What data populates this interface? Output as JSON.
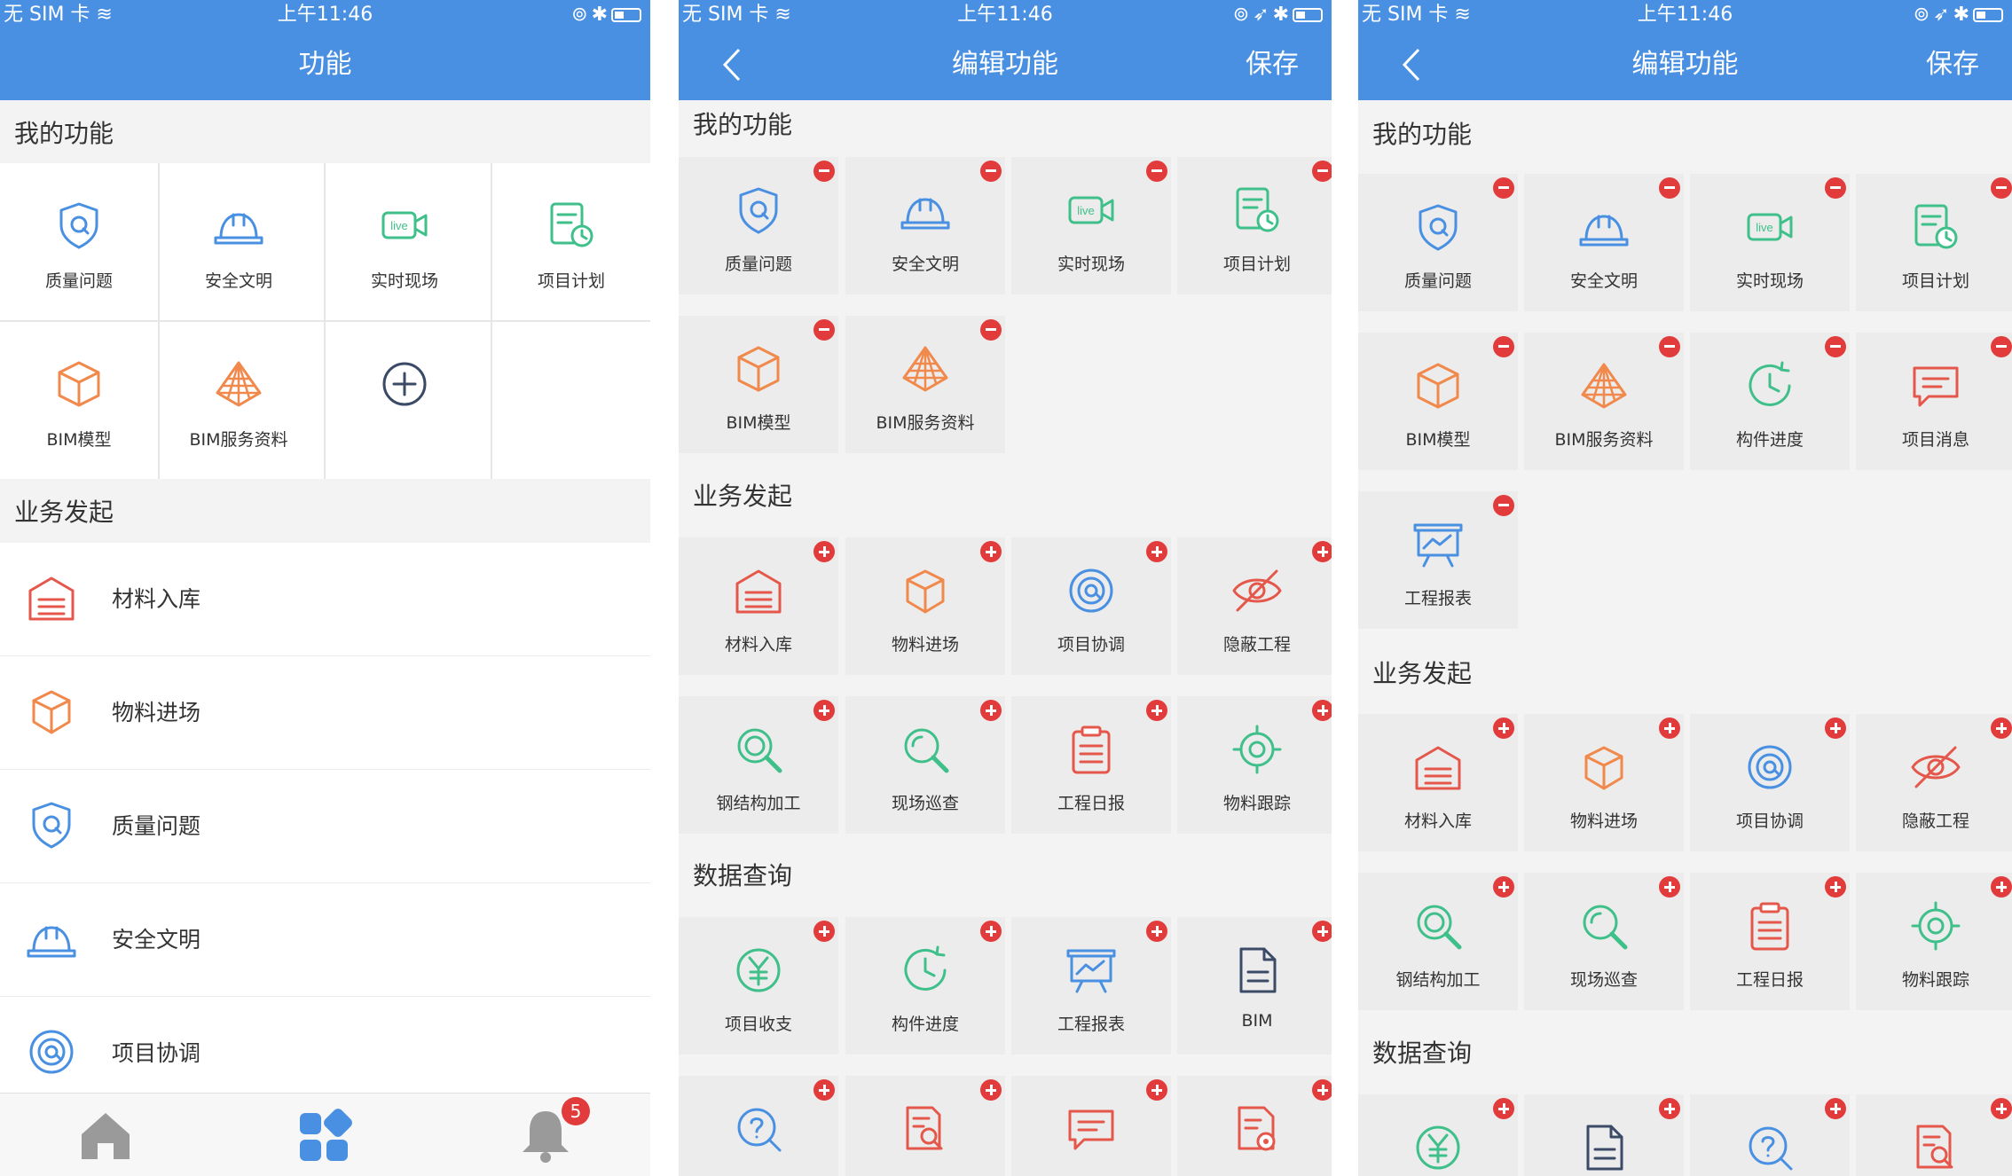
{
  "status_bar": {
    "carrier": "无 SIM 卡",
    "time": "上午11:46"
  },
  "screen1": {
    "title": "功能",
    "section_mine": "我的功能",
    "mine": [
      {
        "label": "质量问题",
        "icon": "shield-q-icon"
      },
      {
        "label": "安全文明",
        "icon": "helmet-icon"
      },
      {
        "label": "实时现场",
        "icon": "live-camera-icon"
      },
      {
        "label": "项目计划",
        "icon": "plan-icon"
      },
      {
        "label": "BIM模型",
        "icon": "cube-icon"
      },
      {
        "label": "BIM服务资料",
        "icon": "pyramid-icon"
      }
    ],
    "section_business": "业务发起",
    "business": [
      {
        "label": "材料入库",
        "icon": "warehouse-icon"
      },
      {
        "label": "物料进场",
        "icon": "box-icon"
      },
      {
        "label": "质量问题",
        "icon": "shield-q-icon"
      },
      {
        "label": "安全文明",
        "icon": "helmet-icon"
      },
      {
        "label": "项目协调",
        "icon": "coordination-icon"
      }
    ],
    "tabs": [
      "home-icon",
      "apps-icon",
      "bell-icon"
    ],
    "notification_count": "5"
  },
  "screen2": {
    "title": "编辑功能",
    "save_label": "保存",
    "section_mine": "我的功能",
    "mine": [
      {
        "label": "质量问题",
        "icon": "shield-q-icon"
      },
      {
        "label": "安全文明",
        "icon": "helmet-icon"
      },
      {
        "label": "实时现场",
        "icon": "live-camera-icon"
      },
      {
        "label": "项目计划",
        "icon": "plan-icon"
      },
      {
        "label": "BIM模型",
        "icon": "cube-icon"
      },
      {
        "label": "BIM服务资料",
        "icon": "pyramid-icon"
      }
    ],
    "section_business": "业务发起",
    "business": [
      {
        "label": "材料入库",
        "icon": "warehouse-icon"
      },
      {
        "label": "物料进场",
        "icon": "box-icon"
      },
      {
        "label": "项目协调",
        "icon": "coordination-icon"
      },
      {
        "label": "隐蔽工程",
        "icon": "hidden-eye-icon"
      },
      {
        "label": "钢结构加工",
        "icon": "steel-search-icon"
      },
      {
        "label": "现场巡查",
        "icon": "inspection-icon"
      },
      {
        "label": "工程日报",
        "icon": "daily-report-icon"
      },
      {
        "label": "物料跟踪",
        "icon": "tracking-icon"
      }
    ],
    "section_query": "数据查询",
    "query": [
      {
        "label": "项目收支",
        "icon": "yuan-icon"
      },
      {
        "label": "构件进度",
        "icon": "clock-progress-icon"
      },
      {
        "label": "工程报表",
        "icon": "chart-board-icon"
      },
      {
        "label": "BIM",
        "icon": "document-icon"
      },
      {
        "label": "",
        "icon": "question-search-icon"
      },
      {
        "label": "",
        "icon": "doc-search-icon"
      },
      {
        "label": "",
        "icon": "message-icon"
      },
      {
        "label": "",
        "icon": "doc-stamp-icon"
      }
    ]
  },
  "screen3": {
    "title": "编辑功能",
    "save_label": "保存",
    "section_mine": "我的功能",
    "mine": [
      {
        "label": "质量问题",
        "icon": "shield-q-icon"
      },
      {
        "label": "安全文明",
        "icon": "helmet-icon"
      },
      {
        "label": "实时现场",
        "icon": "live-camera-icon"
      },
      {
        "label": "项目计划",
        "icon": "plan-icon"
      },
      {
        "label": "BIM模型",
        "icon": "cube-icon"
      },
      {
        "label": "BIM服务资料",
        "icon": "pyramid-icon"
      },
      {
        "label": "构件进度",
        "icon": "clock-progress-icon"
      },
      {
        "label": "项目消息",
        "icon": "message-icon"
      },
      {
        "label": "工程报表",
        "icon": "chart-board-icon"
      }
    ],
    "section_business": "业务发起",
    "business": [
      {
        "label": "材料入库",
        "icon": "warehouse-icon"
      },
      {
        "label": "物料进场",
        "icon": "box-icon"
      },
      {
        "label": "项目协调",
        "icon": "coordination-icon"
      },
      {
        "label": "隐蔽工程",
        "icon": "hidden-eye-icon"
      },
      {
        "label": "钢结构加工",
        "icon": "steel-search-icon"
      },
      {
        "label": "现场巡查",
        "icon": "inspection-icon"
      },
      {
        "label": "工程日报",
        "icon": "daily-report-icon"
      },
      {
        "label": "物料跟踪",
        "icon": "tracking-icon"
      }
    ],
    "section_query": "数据查询",
    "query": [
      {
        "label": "",
        "icon": "yuan-icon"
      },
      {
        "label": "",
        "icon": "document-icon"
      },
      {
        "label": "",
        "icon": "question-search-icon"
      },
      {
        "label": "",
        "icon": "doc-search-icon"
      }
    ]
  },
  "colors": {
    "nav": "#4a90e2",
    "blue": "#4a90e2",
    "orange": "#f0894b",
    "green": "#3fc08a",
    "red": "#e4574a",
    "badge": "#e23b3b"
  }
}
